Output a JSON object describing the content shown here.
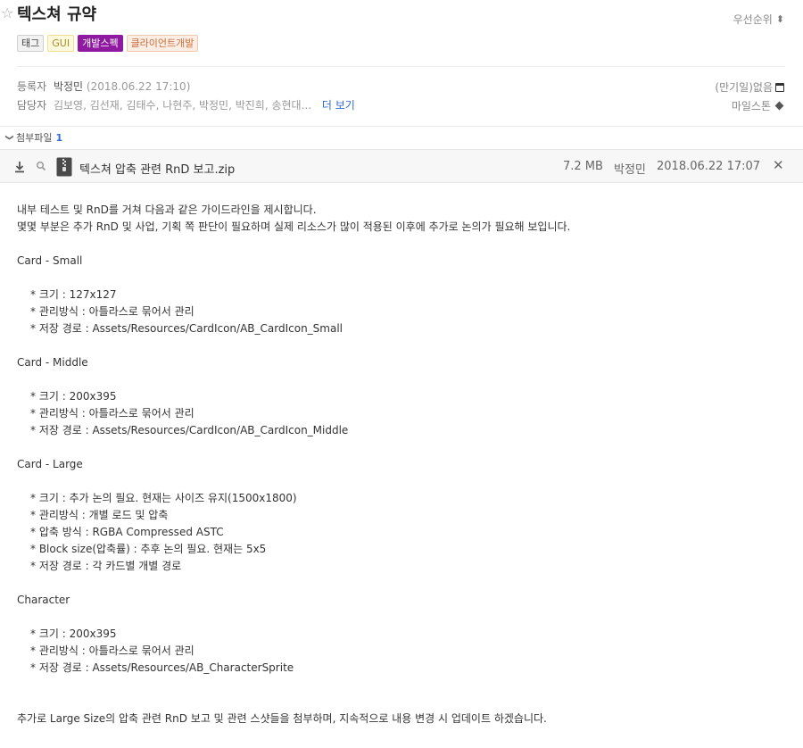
{
  "header": {
    "title": "텍스쳐 규약",
    "priority_label": "우선순위",
    "tags": [
      "태그",
      "GUI",
      "개발스펙",
      "클라이언트개발"
    ]
  },
  "meta": {
    "registrant_label": "등록자",
    "registrant": "박정민",
    "registered_at": "(2018.06.22 17:10)",
    "assignee_label": "담당자",
    "assignees": "김보영, 김선재, 김태수, 나현주, 박정민, 박진희, 송현대...",
    "more_label": "더 보기",
    "due_label": "(만기일)없음",
    "milestone_label": "마일스톤"
  },
  "attachments": {
    "label": "첨부파일",
    "count": "1",
    "file": {
      "name": "텍스쳐 압축 관련 RnD 보고.zip",
      "size": "7.2 MB",
      "owner": "박정민",
      "date": "2018.06.22 17:07"
    }
  },
  "content": {
    "intro1": "내부 테스트 및 RnD를 거쳐 다음과 같은 가이드라인을 제시합니다.",
    "intro2": "몇몇 부분은 추가 RnD 및 사업, 기획 쪽 판단이 필요하며 실제 리소스가 많이 적용된 이후에 추가로 논의가 필요해 보입니다.",
    "sections": [
      {
        "title": "Card - Small",
        "items": [
          "* 크기 : 127x127",
          "* 관리방식 : 아틀라스로 묶어서 관리",
          "* 저장 경로 : Assets/Resources/CardIcon/AB_CardIcon_Small"
        ]
      },
      {
        "title": "Card - Middle",
        "items": [
          "* 크기 : 200x395",
          "* 관리방식 : 아틀라스로 묶어서 관리",
          "* 저장 경로 : Assets/Resources/CardIcon/AB_CardIcon_Middle"
        ]
      },
      {
        "title": "Card - Large",
        "items": [
          "* 크기 : 추가 논의 필요. 현재는 사이즈 유지(1500x1800)",
          "* 관리방식 : 개별 로드 및 압축",
          "* 압축 방식 : RGBA Compressed ASTC",
          "* Block size(압축률) : 추후 논의 필요. 현재는 5x5",
          "* 저장 경로 : 각 카드별 개별 경로"
        ]
      },
      {
        "title": "Character",
        "items": [
          "* 크기 : 200x395",
          "* 관리방식 : 아틀라스로 묶어서 관리",
          "* 저장 경로 : Assets/Resources/AB_CharacterSprite"
        ]
      }
    ],
    "outro": "추가로 Large Size의 압축 관련 RnD 보고 및 관련 스샷들을 첨부하며, 지속적으로 내용 변경 시 업데이트 하겠습니다."
  }
}
